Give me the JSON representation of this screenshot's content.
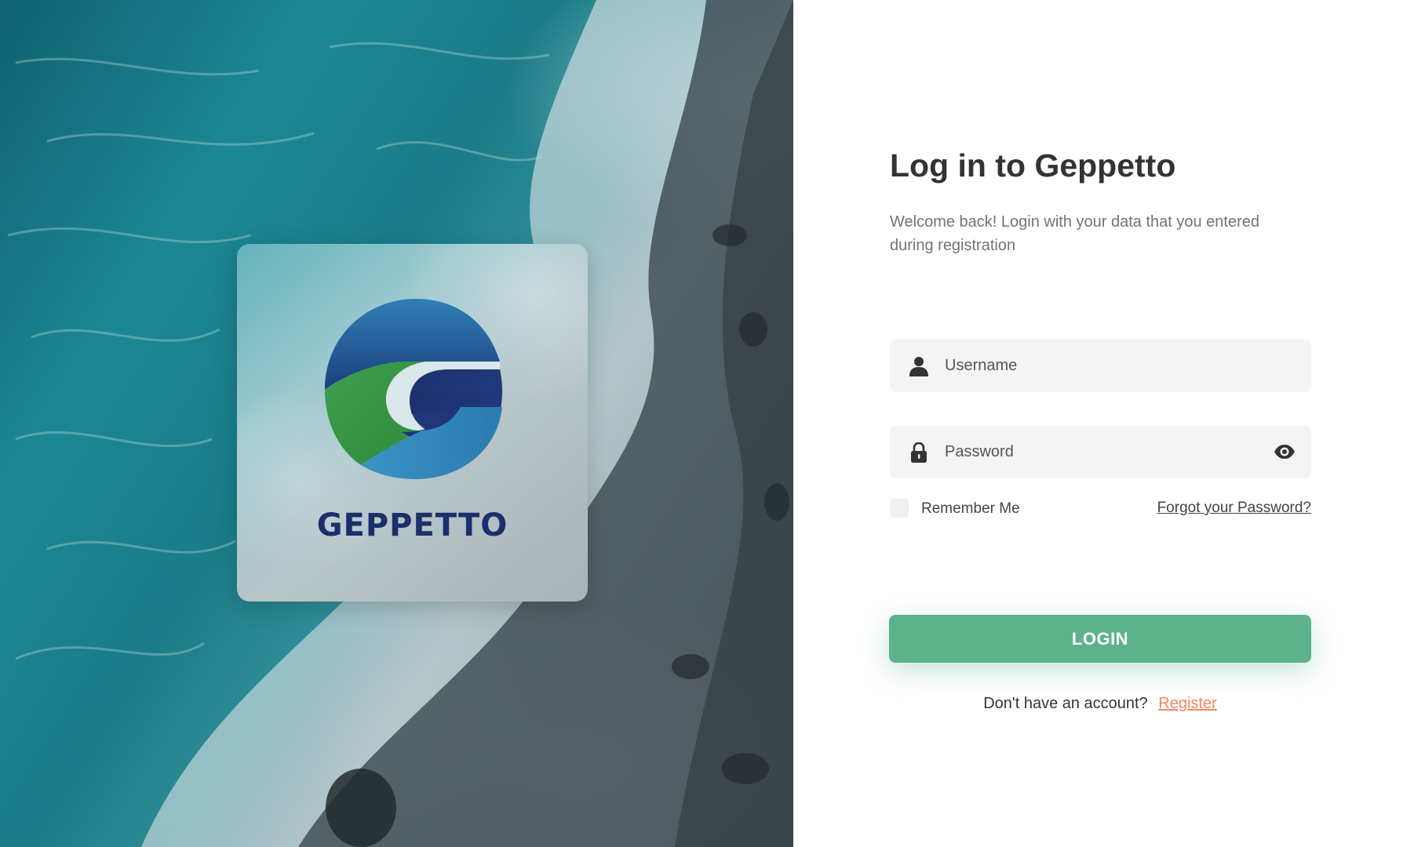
{
  "hero": {
    "logo_text": "GEPPETTO",
    "colors": {
      "logo_blue": "#1b2f6b",
      "logo_green": "#3a9a48",
      "logo_light_blue": "#3a87b8"
    }
  },
  "form": {
    "title": "Log in to Geppetto",
    "subtitle": "Welcome back! Login with your data that you entered during registration",
    "username": {
      "placeholder": "Username",
      "value": "",
      "icon": "user-icon"
    },
    "password": {
      "placeholder": "Password",
      "value": "",
      "icon": "lock-icon",
      "toggle_icon": "eye-icon"
    },
    "remember_label": "Remember Me",
    "remember_checked": false,
    "forgot_label": "Forgot your Password?",
    "login_label": "LOGIN",
    "no_account_text": "Don't have an account?",
    "register_label": "Register"
  },
  "colors": {
    "accent_green": "#5cb38b",
    "link_orange": "#f0875f",
    "text_dark": "#333333",
    "text_muted": "#737373",
    "field_bg": "#f4f4f4"
  }
}
